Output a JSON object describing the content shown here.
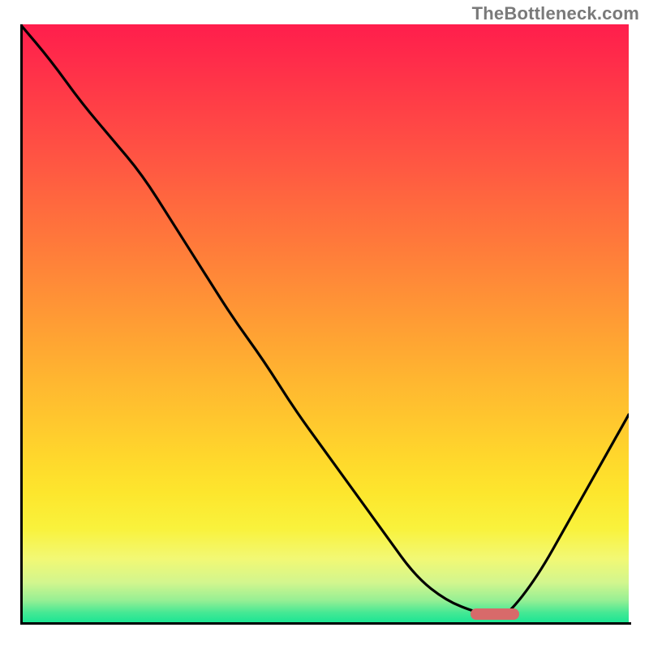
{
  "watermark": "TheBottleneck.com",
  "chart_data": {
    "type": "line",
    "title": "",
    "xlabel": "",
    "ylabel": "",
    "xlim": [
      0,
      100
    ],
    "ylim": [
      0,
      100
    ],
    "grid": false,
    "legend": false,
    "series": [
      {
        "name": "curve",
        "color": "#000000",
        "x": [
          0,
          5,
          10,
          15,
          20,
          25,
          30,
          35,
          40,
          45,
          50,
          55,
          60,
          65,
          70,
          75,
          78,
          80,
          85,
          90,
          95,
          100
        ],
        "y": [
          100,
          94,
          87,
          81,
          75,
          67,
          59,
          51,
          44,
          36,
          29,
          22,
          15,
          8,
          4,
          2,
          1.5,
          1.5,
          8,
          17,
          26,
          35
        ]
      }
    ],
    "optimum_marker": {
      "x_start": 74,
      "x_end": 82,
      "y": 1.8
    },
    "background_gradient": [
      {
        "stop": 0.0,
        "color": "#ff1e4c"
      },
      {
        "stop": 0.5,
        "color": "#ff9835"
      },
      {
        "stop": 0.85,
        "color": "#f9f23c"
      },
      {
        "stop": 1.0,
        "color": "#12e593"
      }
    ]
  }
}
